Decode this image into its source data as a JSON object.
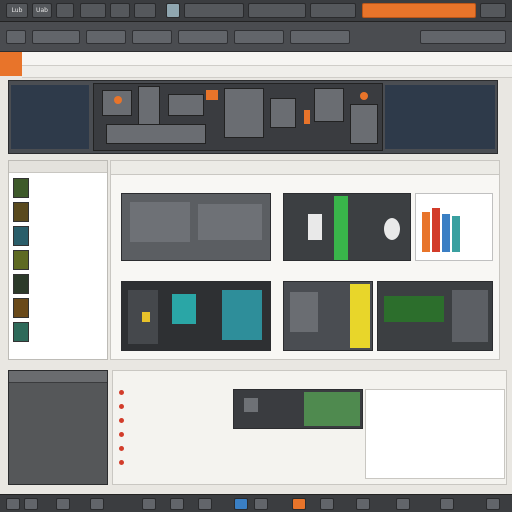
{
  "window": {
    "title": ""
  },
  "topbar": {
    "buttons": [
      {
        "label": "Lub"
      },
      {
        "label": "Uab"
      },
      {
        "label": ""
      },
      {
        "label": ""
      },
      {
        "label": ""
      },
      {
        "label": ""
      },
      {
        "label": ""
      },
      {
        "label": ""
      },
      {
        "label": ""
      },
      {
        "label": ""
      },
      {
        "label": ""
      },
      {
        "label": ""
      }
    ]
  },
  "menubar": {
    "buttons": [
      {
        "label": ""
      },
      {
        "label": ""
      },
      {
        "label": ""
      },
      {
        "label": ""
      },
      {
        "label": ""
      },
      {
        "label": ""
      },
      {
        "label": ""
      },
      {
        "label": ""
      }
    ]
  },
  "ribbon": {
    "text": ""
  },
  "subribbon": {
    "text": ""
  },
  "banner": {
    "panel_left_label": "",
    "panel_right_label": ""
  },
  "leftrail": {
    "header": "",
    "items": [
      {
        "label": ""
      },
      {
        "label": ""
      },
      {
        "label": ""
      },
      {
        "label": ""
      },
      {
        "label": ""
      },
      {
        "label": ""
      },
      {
        "label": ""
      },
      {
        "label": ""
      }
    ]
  },
  "main": {
    "tabs_text": "",
    "panes": [
      {
        "caption": ""
      },
      {
        "caption": ""
      },
      {
        "caption": ""
      },
      {
        "caption": ""
      },
      {
        "caption": ""
      },
      {
        "caption": ""
      }
    ]
  },
  "lowerleft": {
    "header": ""
  },
  "bottom": {
    "rows": [
      {
        "label": ""
      },
      {
        "label": ""
      },
      {
        "label": ""
      },
      {
        "label": ""
      },
      {
        "label": ""
      },
      {
        "label": ""
      }
    ]
  },
  "colors": {
    "accent": "#e8742a",
    "dark": "#3b3d40",
    "panel": "#4a4d52"
  }
}
